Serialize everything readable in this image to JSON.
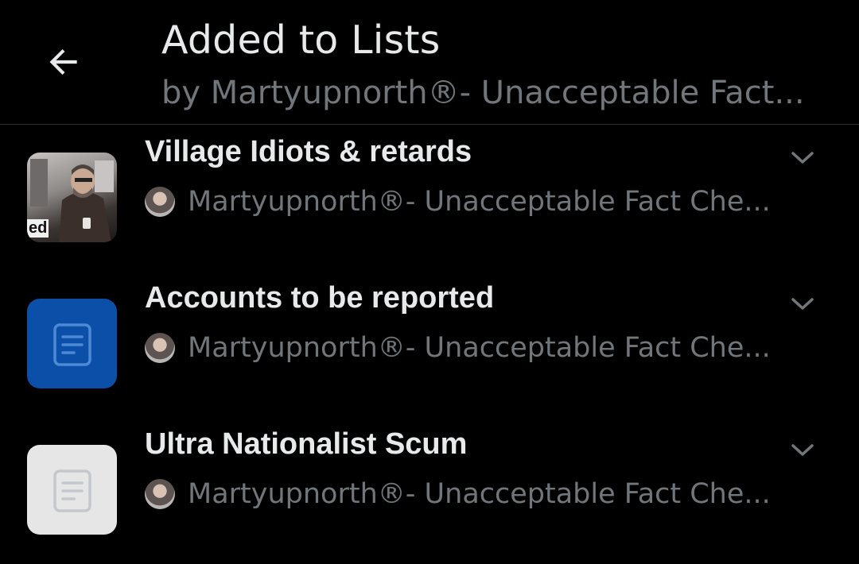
{
  "header": {
    "title": "Added to Lists",
    "subtitle": "by Martyupnorth®- Unacceptable Fact..."
  },
  "lists": [
    {
      "name": "Village Idiots & retards",
      "owner": "Martyupnorth®- Unacceptable Fact Che...",
      "thumb_style": "photo",
      "thumb_text": "ed"
    },
    {
      "name": "Accounts to be reported",
      "owner": "Martyupnorth®- Unacceptable Fact Che...",
      "thumb_style": "blue"
    },
    {
      "name": "Ultra Nationalist Scum",
      "owner": "Martyupnorth®- Unacceptable Fact Che...",
      "thumb_style": "grey"
    }
  ],
  "icons": {
    "back": "arrow-left-icon",
    "expand": "chevron-down-icon",
    "list": "document-list-icon"
  },
  "colors": {
    "background": "#000000",
    "primary_text": "#e7e9ea",
    "secondary_text": "#71767b",
    "divider": "#2f3336",
    "blue_thumb": "#0b4fa8",
    "grey_thumb": "#e6e6e6"
  }
}
